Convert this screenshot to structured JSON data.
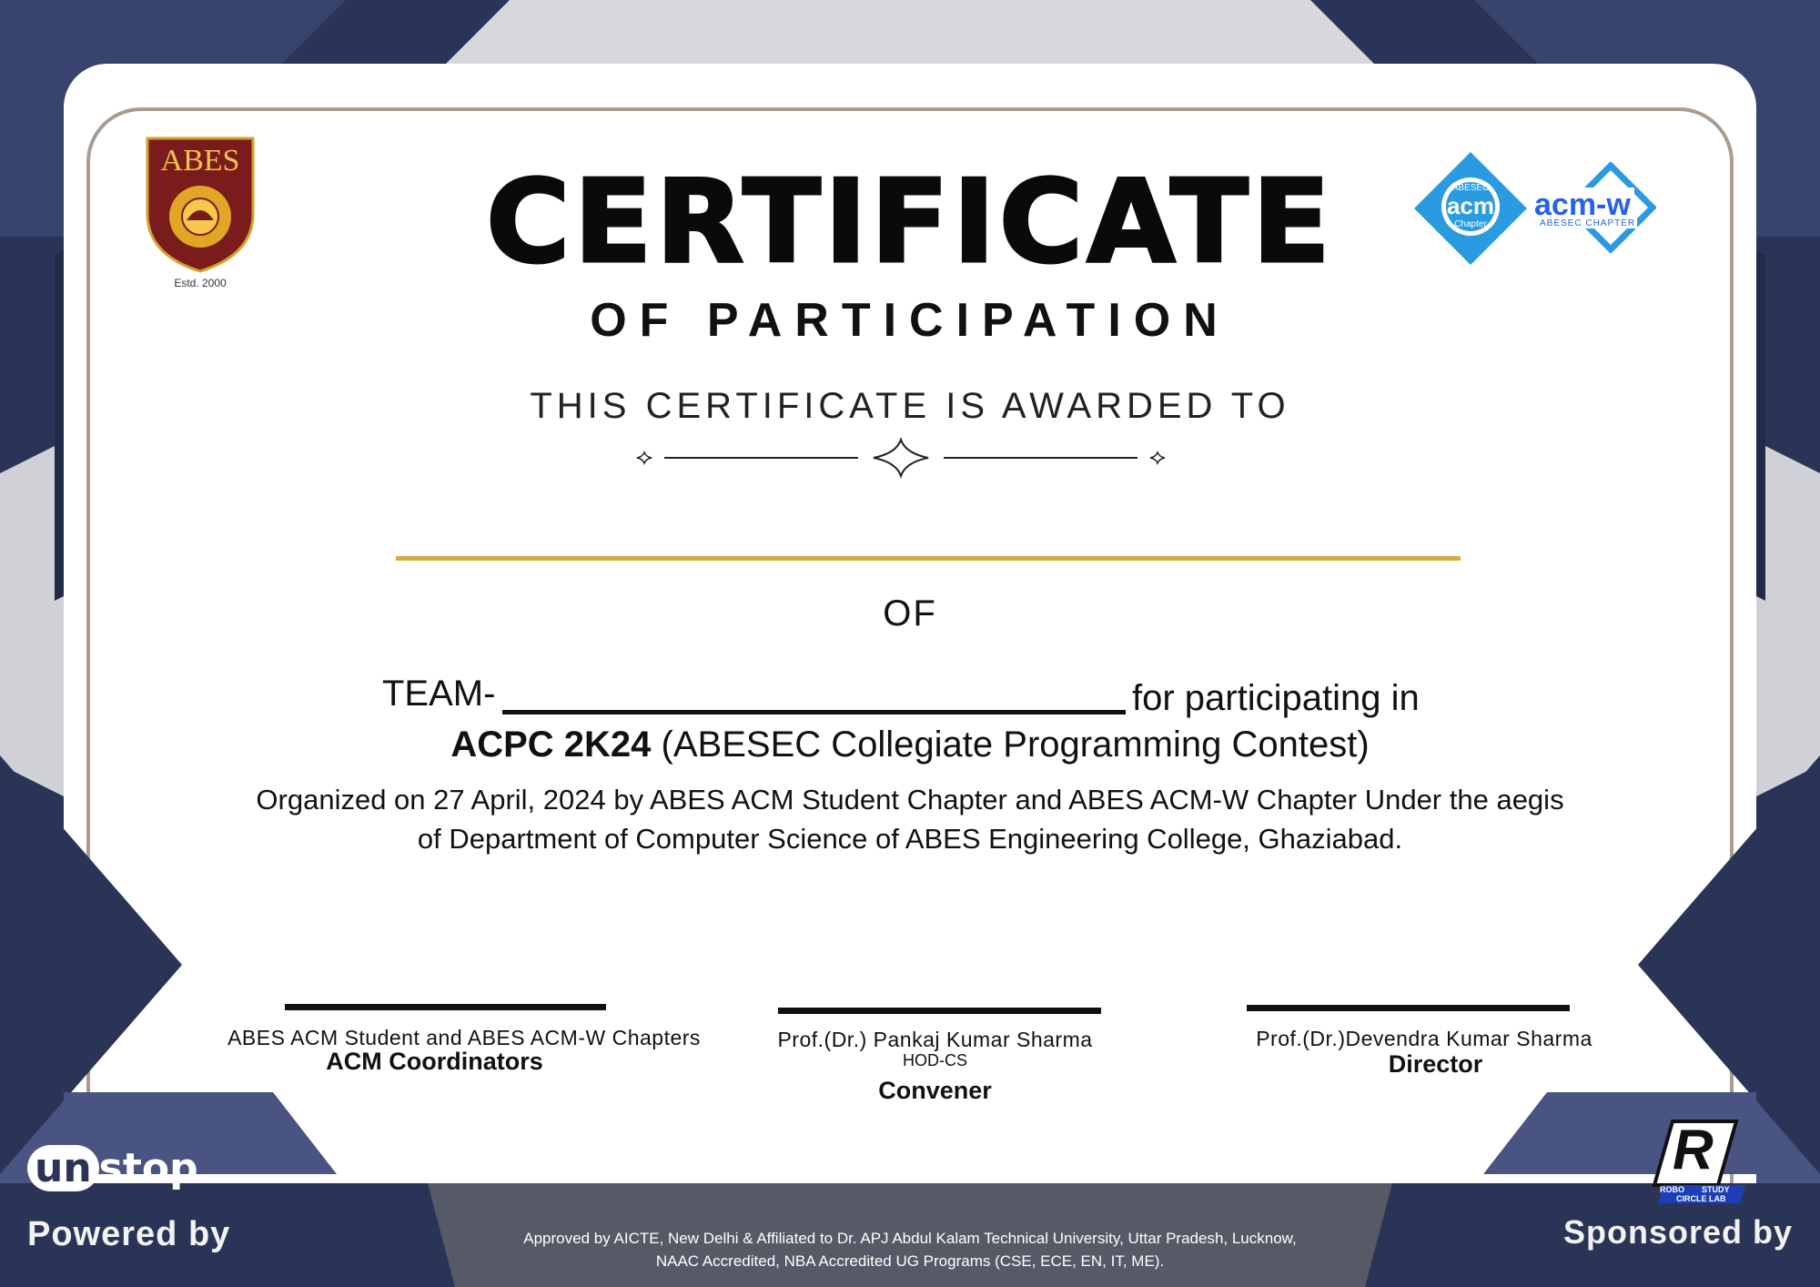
{
  "certificate": {
    "title": "CERTIFICATE",
    "subtitle": "OF PARTICIPATION",
    "awarded_to": "THIS CERTIFICATE IS AWARDED TO",
    "of": "OF",
    "team_label": "TEAM-",
    "participating_text": "for participating in",
    "contest_name": "ACPC 2K24",
    "contest_full": "(ABESEC Collegiate Programming Contest)",
    "organized_line1": "Organized on 27 April, 2024 by ABES ACM Student Chapter and ABES ACM-W Chapter Under the aegis",
    "organized_line2": "of Department of Computer Science of ABES Engineering College, Ghaziabad."
  },
  "logos": {
    "abes_name": "ABES",
    "abes_estd": "Estd. 2000",
    "acm_top": "ABESEC",
    "acm_name": "acm",
    "acm_bottom": "Chapter",
    "acmw_name": "acm-w",
    "acmw_sub": "ABESEC CHAPTER",
    "unstop_un": "un",
    "unstop_stop": "stop",
    "robo_letter": "R",
    "robo_text1": "ROBO",
    "robo_text2": "STUDY",
    "robo_text3": "CIRCLE LAB"
  },
  "signatures": [
    {
      "name": "ABES ACM Student and ABES ACM-W Chapters",
      "role": "ACM Coordinators"
    },
    {
      "name": "Prof.(Dr.) Pankaj Kumar Sharma",
      "sub": "HOD-CS",
      "role": "Convener"
    },
    {
      "name": "Prof.(Dr.)Devendra Kumar Sharma",
      "role": "Director"
    }
  ],
  "footer": {
    "line1": "Approved by AICTE, New Delhi & Affiliated to Dr. APJ Abdul Kalam Technical University, Uttar Pradesh, Lucknow,",
    "line2": "NAAC Accredited, NBA Accredited UG Programs (CSE, ECE, EN, IT, ME).",
    "powered_by": "Powered by",
    "sponsored_by": "Sponsored by"
  },
  "colors": {
    "navy": "#2a3456",
    "gold_line": "#d4ab43",
    "abes_red": "#7a1c1c",
    "acm_blue": "#2a9be0",
    "acmw_blue": "#2563eb"
  }
}
